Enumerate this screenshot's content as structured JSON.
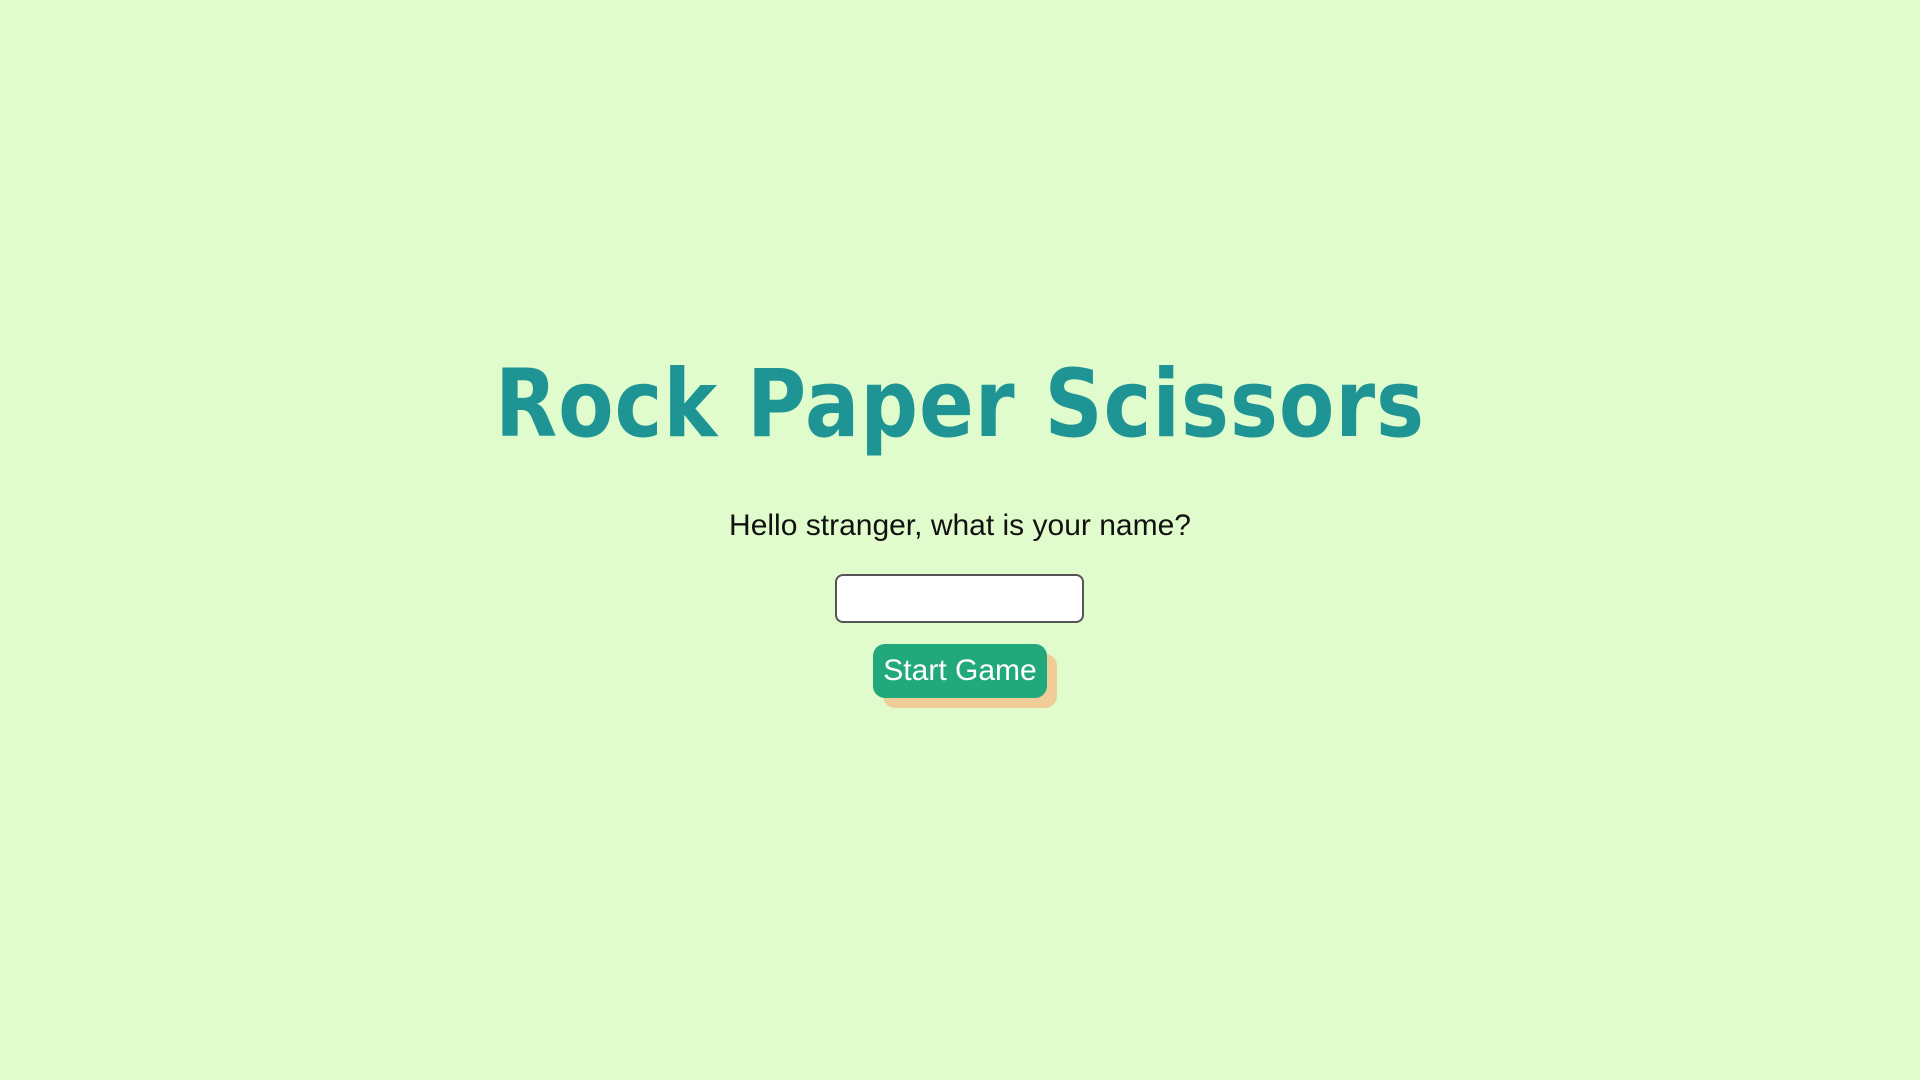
{
  "app": {
    "title": "Rock Paper Scissors"
  },
  "welcome": {
    "prompt": "Hello stranger, what is your name?",
    "name_input": {
      "value": "",
      "placeholder": ""
    },
    "start_button_label": "Start Game"
  },
  "colors": {
    "background": "#e0fccc",
    "title": "#1e9494",
    "button": "#22a97b",
    "button_shadow": "#efcc98",
    "text": "#111111"
  }
}
